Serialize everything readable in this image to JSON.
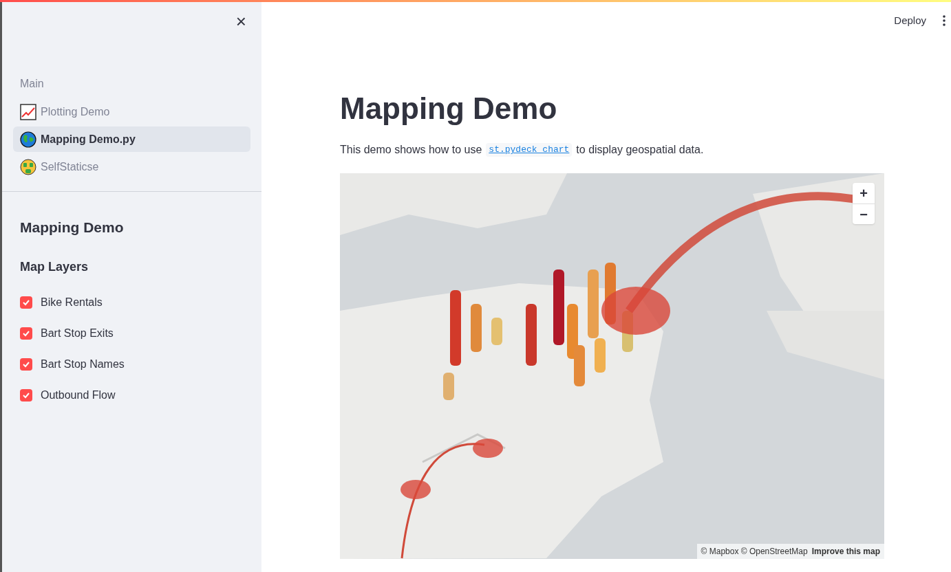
{
  "sidebar": {
    "close": "×",
    "nav_heading": "Main",
    "nav_items": [
      {
        "label": "Plotting Demo",
        "kind": "chart",
        "selected": false
      },
      {
        "label": "Mapping Demo.py",
        "kind": "globe",
        "selected": true
      },
      {
        "label": "SelfStaticse",
        "kind": "money",
        "selected": false
      }
    ],
    "title": "Mapping Demo",
    "layers_heading": "Map Layers",
    "layers": [
      {
        "label": "Bike Rentals",
        "checked": true
      },
      {
        "label": "Bart Stop Exits",
        "checked": true
      },
      {
        "label": "Bart Stop Names",
        "checked": true
      },
      {
        "label": "Outbound Flow",
        "checked": true
      }
    ]
  },
  "header": {
    "deploy": "Deploy"
  },
  "main": {
    "title": "Mapping Demo",
    "intro_before": "This demo shows how to use",
    "code": "st.pydeck_chart",
    "intro_after": "to display geospatial data.",
    "map": {
      "kind": "picture",
      "zoom_in": "+",
      "zoom_out": "−",
      "attribution": "© Mapbox © OpenStreetMap",
      "improve": "Improve this map"
    }
  }
}
